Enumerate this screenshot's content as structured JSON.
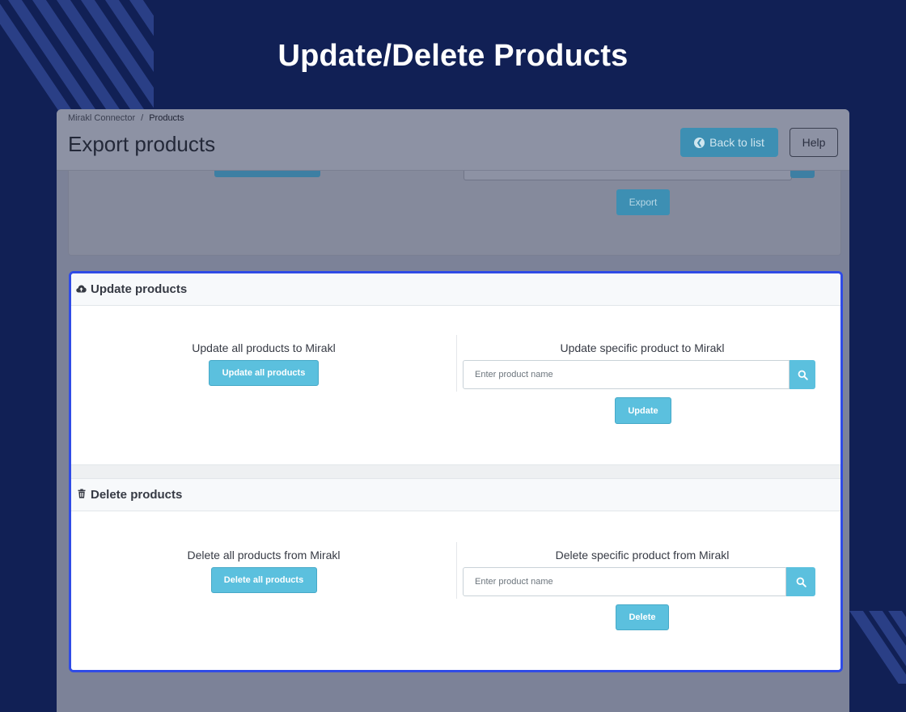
{
  "hero": {
    "title": "Update/Delete Products"
  },
  "breadcrumb": {
    "parent": "Mirakl Connector",
    "separator": "/",
    "current": "Products"
  },
  "header": {
    "title": "Export products",
    "back_label": "Back to list",
    "help_label": "Help"
  },
  "export_card": {
    "export_label": "Export"
  },
  "update_card": {
    "title": "Update products",
    "icon": "cloud-upload-icon",
    "all_label": "Update all products to Mirakl",
    "all_button": "Update all products",
    "specific_label": "Update specific product to Mirakl",
    "input_placeholder": "Enter product name",
    "action_button": "Update"
  },
  "delete_card": {
    "title": "Delete products",
    "icon": "trash-icon",
    "all_label": "Delete all products from Mirakl",
    "all_button": "Delete all products",
    "specific_label": "Delete specific product from Mirakl",
    "input_placeholder": "Enter product name",
    "action_button": "Delete"
  },
  "colors": {
    "background": "#112055",
    "highlight_border": "#2f4be6",
    "button_info": "#5bc0de"
  }
}
